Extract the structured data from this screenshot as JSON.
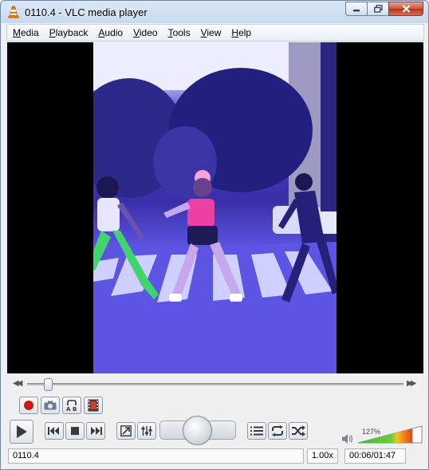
{
  "window": {
    "title": "0110.4 - VLC media player"
  },
  "menu": {
    "items": [
      {
        "label": "Media",
        "mnemonic": "M",
        "rest": "edia"
      },
      {
        "label": "Playback",
        "mnemonic": "P",
        "rest": "layback"
      },
      {
        "label": "Audio",
        "mnemonic": "A",
        "rest": "udio"
      },
      {
        "label": "Video",
        "mnemonic": "V",
        "rest": "ideo"
      },
      {
        "label": "Tools",
        "mnemonic": "T",
        "rest": "ools"
      },
      {
        "label": "View",
        "mnemonic": "V",
        "rest": "iew"
      },
      {
        "label": "Help",
        "mnemonic": "H",
        "rest": "elp"
      }
    ]
  },
  "controls": {
    "seek_position_fraction": 0.056,
    "volume_label": "127%",
    "volume_fraction": 0.85,
    "icons": [
      "record-icon",
      "snapshot-icon",
      "loop-ab-icon",
      "frame-by-frame-icon",
      "play-icon",
      "previous-icon",
      "stop-icon",
      "next-icon",
      "fullscreen-icon",
      "extended-settings-icon",
      "playlist-icon",
      "loop-icon",
      "shuffle-icon",
      "speaker-icon"
    ]
  },
  "status": {
    "file_name": "0110.4",
    "speed": "1.00x",
    "time": "00:06/01:47"
  },
  "colors": {
    "accent_orange": "#f07d00",
    "record_red": "#d41717",
    "volume_green": "#3cb43c",
    "volume_yellow": "#f0c81e",
    "video_purple": "#5a51e0"
  }
}
